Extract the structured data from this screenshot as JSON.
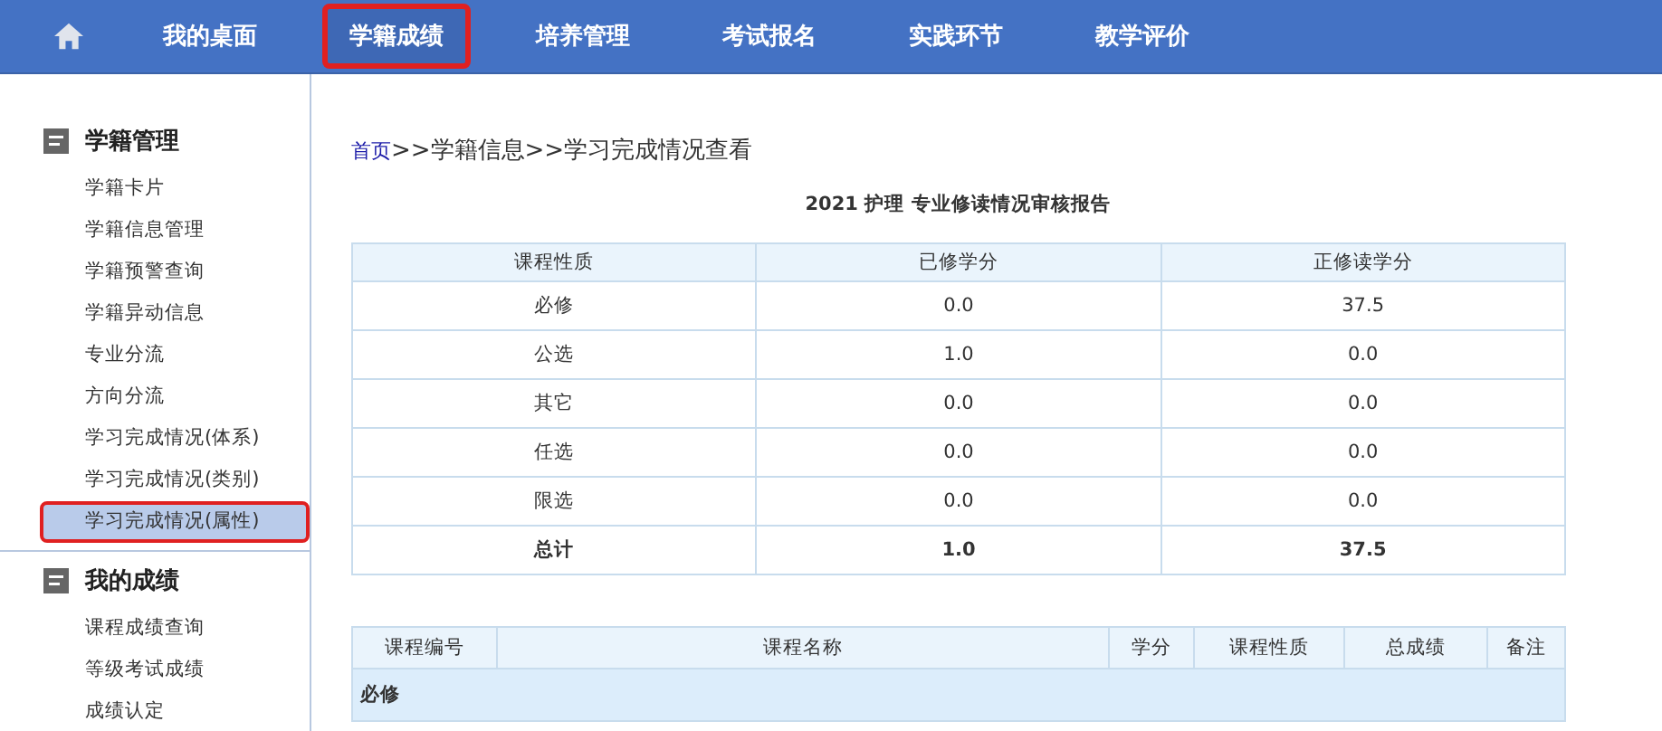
{
  "nav": {
    "items": [
      {
        "label": "我的桌面",
        "selected": false,
        "annotated": false
      },
      {
        "label": "学籍成绩",
        "selected": true,
        "annotated": true
      },
      {
        "label": "培养管理",
        "selected": false,
        "annotated": false
      },
      {
        "label": "考试报名",
        "selected": false,
        "annotated": false
      },
      {
        "label": "实践环节",
        "selected": false,
        "annotated": false
      },
      {
        "label": "教学评价",
        "selected": false,
        "annotated": false
      }
    ]
  },
  "sidebar": {
    "groups": [
      {
        "title": "学籍管理",
        "items": [
          {
            "label": "学籍卡片",
            "selected": false,
            "annotated": false
          },
          {
            "label": "学籍信息管理",
            "selected": false,
            "annotated": false
          },
          {
            "label": "学籍预警查询",
            "selected": false,
            "annotated": false
          },
          {
            "label": "学籍异动信息",
            "selected": false,
            "annotated": false
          },
          {
            "label": "专业分流",
            "selected": false,
            "annotated": false
          },
          {
            "label": "方向分流",
            "selected": false,
            "annotated": false
          },
          {
            "label": "学习完成情况(体系)",
            "selected": false,
            "annotated": false
          },
          {
            "label": "学习完成情况(类别)",
            "selected": false,
            "annotated": false
          },
          {
            "label": "学习完成情况(属性)",
            "selected": true,
            "annotated": true
          }
        ]
      },
      {
        "title": "我的成绩",
        "items": [
          {
            "label": "课程成绩查询",
            "selected": false,
            "annotated": false
          },
          {
            "label": "等级考试成绩",
            "selected": false,
            "annotated": false
          },
          {
            "label": "成绩认定",
            "selected": false,
            "annotated": false
          }
        ]
      }
    ]
  },
  "breadcrumb": {
    "link": "首页",
    "rest": ">>学籍信息>>学习完成情况查看"
  },
  "report_title": "2021 护理  专业修读情况审核报告",
  "summary_table": {
    "columns": [
      "课程性质",
      "已修学分",
      "正修读学分"
    ],
    "rows": [
      {
        "cells": [
          "必修",
          "0.0",
          "37.5"
        ],
        "total": false
      },
      {
        "cells": [
          "公选",
          "1.0",
          "0.0"
        ],
        "total": false
      },
      {
        "cells": [
          "其它",
          "0.0",
          "0.0"
        ],
        "total": false
      },
      {
        "cells": [
          "任选",
          "0.0",
          "0.0"
        ],
        "total": false
      },
      {
        "cells": [
          "限选",
          "0.0",
          "0.0"
        ],
        "total": false
      },
      {
        "cells": [
          "总计",
          "1.0",
          "37.5"
        ],
        "total": true
      }
    ]
  },
  "course_table": {
    "columns": [
      "课程编号",
      "课程名称",
      "学分",
      "课程性质",
      "总成绩",
      "备注"
    ],
    "section": "必修"
  }
}
